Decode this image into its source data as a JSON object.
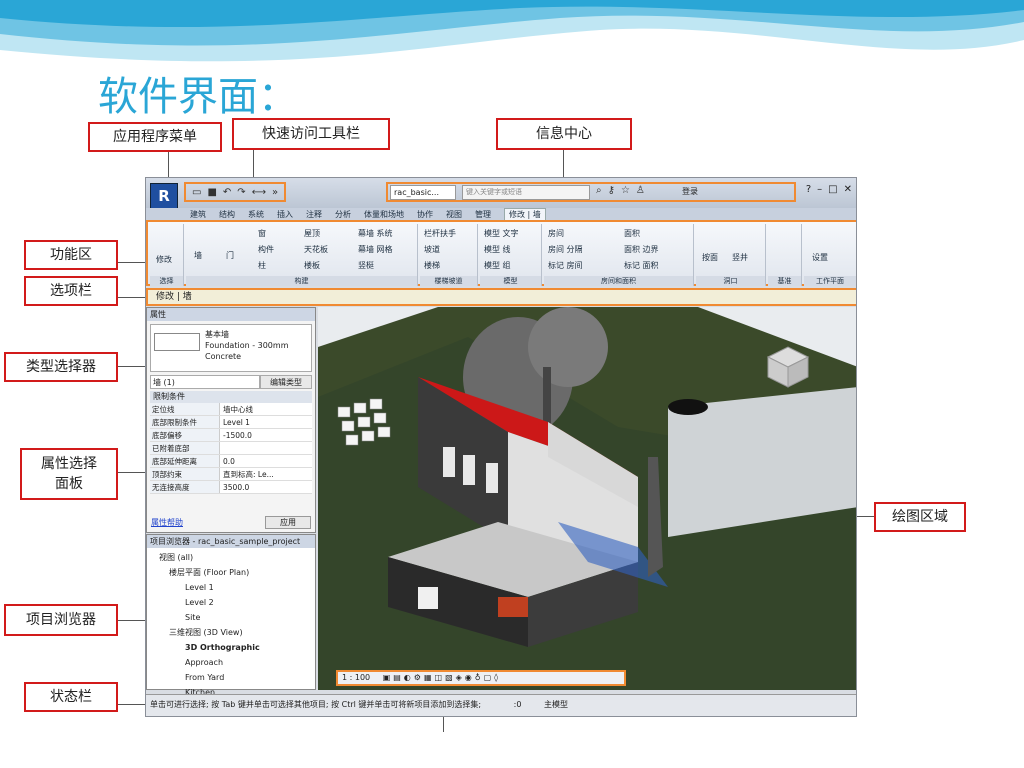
{
  "slide_title": "软件界面：",
  "callouts": {
    "app_menu": "应用程序菜单",
    "quick_access": "快速访问工具栏",
    "info_center": "信息中心",
    "ribbon": "功能区",
    "options_bar": "选项栏",
    "type_selector": "类型选择器",
    "properties_panel": "属性选择面板",
    "project_browser": "项目浏览器",
    "status_bar": "状态栏",
    "drawing_area": "绘图区域"
  },
  "revit": {
    "file_name": "rac_basic...",
    "search_placeholder": "键入关键字或短语",
    "login": "登录",
    "tabs": [
      "建筑",
      "结构",
      "系统",
      "插入",
      "注释",
      "分析",
      "体量和场地",
      "协作",
      "视图",
      "管理",
      "修改 | 墙"
    ],
    "ribbon_groups": [
      {
        "name": "选择",
        "items": [
          "修改"
        ]
      },
      {
        "name": "构建",
        "items": [
          "墙",
          "门",
          "窗",
          "构件",
          "柱",
          "屋顶",
          "天花板",
          "楼板",
          "幕墙 系统",
          "幕墙 网格",
          "竖梃"
        ]
      },
      {
        "name": "楼梯坡道",
        "items": [
          "栏杆扶手",
          "坡道",
          "楼梯"
        ]
      },
      {
        "name": "模型",
        "items": [
          "模型 文字",
          "模型 线",
          "模型 组"
        ]
      },
      {
        "name": "房间和面积",
        "items": [
          "房间",
          "房间 分隔",
          "标记 房间",
          "面积",
          "面积 边界",
          "标记 面积"
        ]
      },
      {
        "name": "洞口",
        "items": [
          "按面",
          "竖井"
        ]
      },
      {
        "name": "基准",
        "items": []
      },
      {
        "name": "工作平面",
        "items": [
          "设置"
        ]
      }
    ],
    "options_bar": "修改 | 墙",
    "properties": {
      "header": "属性",
      "type_family": "基本墙",
      "type_name": "Foundation - 300mm Concrete",
      "instance_selector": "墙 (1)",
      "edit_type": "编辑类型",
      "section": "限制条件",
      "rows": [
        {
          "k": "定位线",
          "v": "墙中心线"
        },
        {
          "k": "底部限制条件",
          "v": "Level 1"
        },
        {
          "k": "底部偏移",
          "v": "-1500.0"
        },
        {
          "k": "已附着底部",
          "v": ""
        },
        {
          "k": "底部延伸距离",
          "v": "0.0"
        },
        {
          "k": "顶部约束",
          "v": "直到标高: Le..."
        },
        {
          "k": "无连接高度",
          "v": "3500.0"
        }
      ],
      "help": "属性帮助",
      "apply": "应用"
    },
    "browser": {
      "header": "项目浏览器 - rac_basic_sample_project",
      "items": [
        "视图 (all)",
        "楼层平面 (Floor Plan)",
        "Level 1",
        "Level 2",
        "Site",
        "三维视图 (3D View)",
        "3D Orthographic",
        "Approach",
        "From Yard",
        "Kitchen"
      ]
    },
    "view_scale": "1 : 100",
    "status_text": "单击可进行选择; 按 Tab 键并单击可选择其他项目; 按 Ctrl 键并单击可将新项目添加到选择集;",
    "status_right": ":0",
    "main_model": "主模型"
  }
}
